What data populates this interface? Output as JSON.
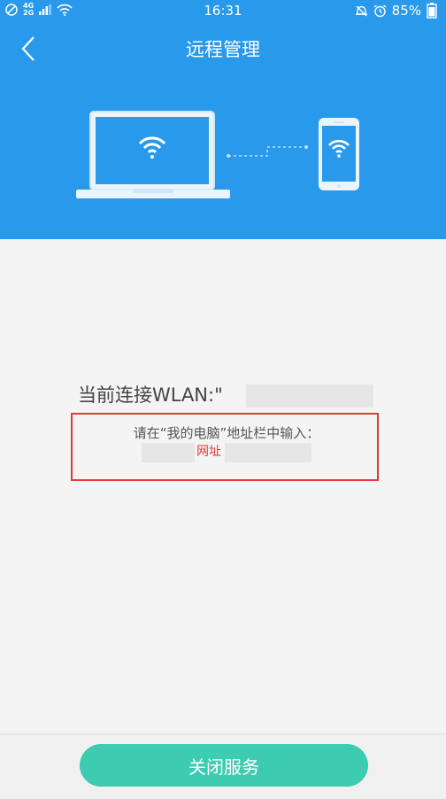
{
  "status_bar": {
    "network_top": "4G",
    "network_bottom": "2G",
    "time": "16:31",
    "battery": "85%"
  },
  "header": {
    "title": "远程管理",
    "back_icon": "chevron-left-icon"
  },
  "illustration": {
    "laptop_icon": "laptop-icon",
    "phone_icon": "phone-icon",
    "wifi_icon": "wifi-icon"
  },
  "connection": {
    "label": "当前连接WLAN:\""
  },
  "instructions": {
    "text": "请在“我的电脑”地址栏中输入：",
    "url_label": "网址"
  },
  "bottom": {
    "close_button_label": "关闭服务"
  },
  "colors": {
    "header_bg": "#2899eb",
    "button_bg": "#3dccb2",
    "highlight_red": "#e53935"
  }
}
